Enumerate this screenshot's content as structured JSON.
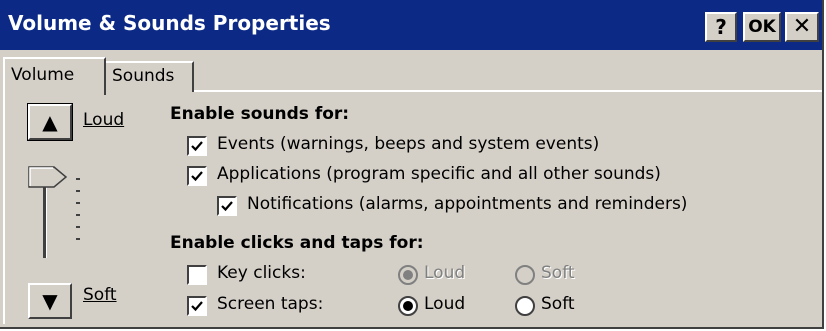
{
  "window": {
    "title": "Volume & Sounds Properties",
    "help_label": "?",
    "ok_label": "OK",
    "close_label": "✕"
  },
  "tabs": [
    {
      "label": "Volume",
      "selected": true
    },
    {
      "label": "Sounds",
      "selected": false
    }
  ],
  "volume": {
    "up_arrow": "▲",
    "down_arrow": "▼",
    "loud_label": "Loud",
    "soft_label": "Soft",
    "slider_level": 1.0
  },
  "enable_sounds": {
    "heading": "Enable sounds for:",
    "items": [
      {
        "label": "Events (warnings, beeps and system events)",
        "checked": true
      },
      {
        "label": "Applications (program specific and all other sounds)",
        "checked": true
      },
      {
        "label": "Notifications (alarms, appointments and reminders)",
        "checked": true
      }
    ]
  },
  "enable_clicks": {
    "heading": "Enable clicks and taps for:",
    "key_clicks": {
      "label": "Key clicks:",
      "checked": false,
      "loud": "Loud",
      "soft": "Soft",
      "selected": "Loud",
      "enabled": false
    },
    "screen_taps": {
      "label": "Screen taps:",
      "checked": true,
      "loud": "Loud",
      "soft": "Soft",
      "selected": "Loud",
      "enabled": true
    }
  },
  "colors": {
    "titlebar": "#0c2a85",
    "face": "#d4d0c8"
  }
}
